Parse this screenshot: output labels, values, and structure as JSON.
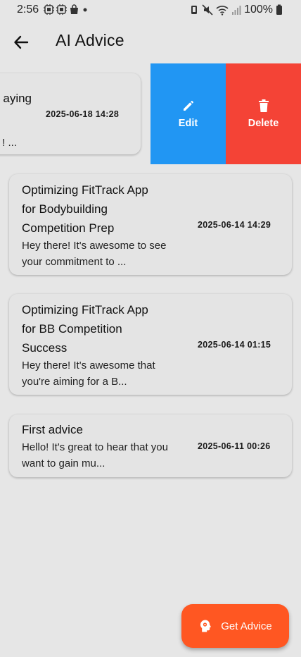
{
  "status_bar": {
    "time": "2:56",
    "battery_percent": "100%",
    "left_icons": [
      "sim-icon",
      "sim-icon",
      "shopping-bag-icon",
      "dot-icon"
    ],
    "right_icons": [
      "vibrate-icon",
      "mute-icon",
      "wifi-icon",
      "signal-icon",
      "battery-icon"
    ]
  },
  "app_bar": {
    "title": "AI Advice",
    "back_icon": "arrow-left-icon"
  },
  "swiped_item": {
    "title_fragment": "aying",
    "date": "2025-06-18 14:28",
    "preview_fragment": "! ...",
    "actions": {
      "edit_label": "Edit",
      "delete_label": "Delete",
      "edit_color": "#2196f3",
      "delete_color": "#f44336"
    }
  },
  "advice_items": [
    {
      "title_lines": [
        "Optimizing FitTrack App",
        "for Bodybuilding",
        "Competition Prep"
      ],
      "date": "2025-06-14 14:29",
      "preview_lines": [
        "Hey there! It's awesome to see",
        "your commitment to ..."
      ]
    },
    {
      "title_lines": [
        "Optimizing FitTrack App",
        "for BB Competition",
        "Success"
      ],
      "date": "2025-06-14 01:15",
      "preview_lines": [
        "Hey there! It's awesome that",
        "you're aiming for a B..."
      ]
    },
    {
      "title_lines": [
        "First advice"
      ],
      "date": "2025-06-11 00:26",
      "preview_lines": [
        "Hello! It's great to hear that you",
        "want to gain mu..."
      ]
    }
  ],
  "fab": {
    "label": "Get Advice",
    "icon": "head-gear-icon",
    "color": "#ff5722"
  }
}
